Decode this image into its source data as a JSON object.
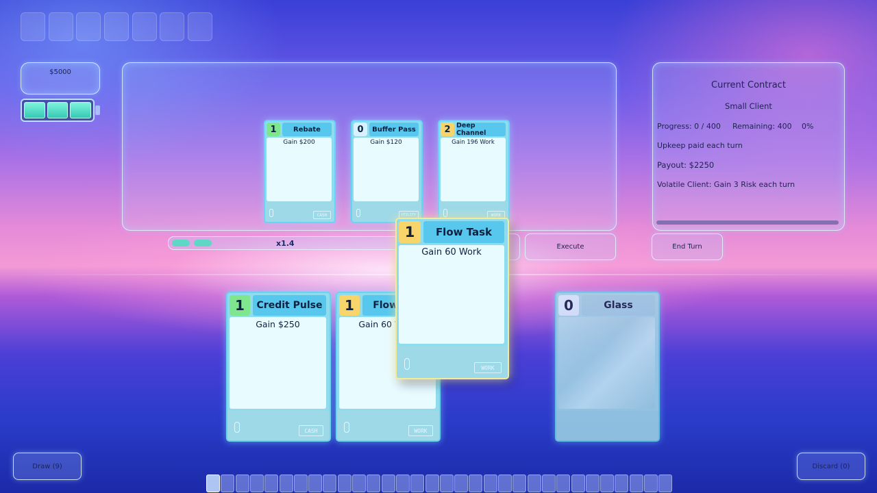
{
  "wallet": {
    "cash": "$5000"
  },
  "energy": {
    "filled": 3,
    "max": 3
  },
  "board_cards": [
    {
      "cost": "1",
      "cost_color": "green",
      "name": "Rebate",
      "text": "Gain $200",
      "tag": "CASH"
    },
    {
      "cost": "0",
      "cost_color": "white",
      "name": "Buffer Pass",
      "text": "Gain $120",
      "tag": "UTILITY"
    },
    {
      "cost": "2",
      "cost_color": "yellow",
      "name": "Deep Channel",
      "text": "Gain 196 Work",
      "tag": "WORK"
    }
  ],
  "multiplier": {
    "label": "x1.4"
  },
  "buttons": {
    "execute": "Execute",
    "end_turn": "End Turn",
    "draw": "Draw (9)",
    "discard": "Discard (0)"
  },
  "contract": {
    "title": "Current Contract",
    "client": "Small Client",
    "progress": "Progress: 0 / 400",
    "remaining": "Remaining: 400",
    "percent": "0%",
    "upkeep": "Upkeep paid each turn",
    "payout": "Payout: $2250",
    "modifier": "Volatile Client: Gain 3 Risk each turn",
    "progress_fraction": 0
  },
  "hand": [
    {
      "cost": "1",
      "cost_color": "green",
      "name": "Credit Pulse",
      "text": "Gain $250",
      "tag": "CASH"
    },
    {
      "cost": "1",
      "cost_color": "yellow",
      "name": "Flow Task",
      "text": "Gain 60 Work",
      "tag": "WORK"
    },
    {
      "cost": "0",
      "cost_color": "white",
      "name": "Glass",
      "text": "",
      "tag": ""
    }
  ],
  "held_card": {
    "cost": "1",
    "cost_color": "yellow",
    "name": "Flow Task",
    "text": "Gain 60 Work",
    "tag": "WORK"
  },
  "colors": {
    "cash_cost": "#7ee68d",
    "work_cost": "#f7d56b",
    "neutral_cost": "#d7f2ff",
    "card_frame": "#66d4f4"
  }
}
